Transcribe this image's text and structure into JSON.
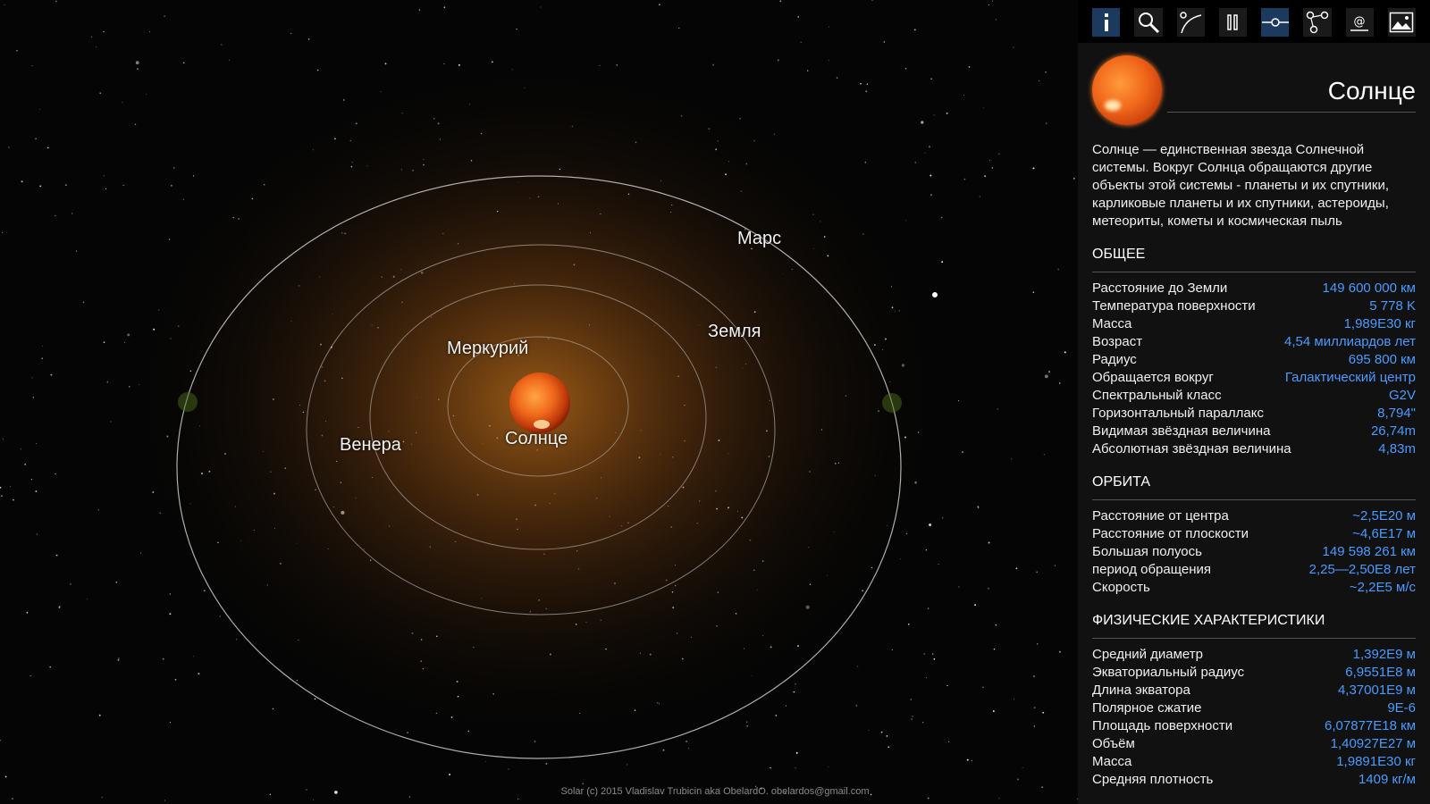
{
  "scene": {
    "labels": {
      "mars": "Марс",
      "earth": "Земля",
      "mercury": "Меркурий",
      "venus": "Венера",
      "sun": "Солнце"
    },
    "credit": "Solar (c) 2015 Vladislav Trubicin aka ObelardO. obelardos@gmail.com"
  },
  "toolbar": {
    "icons": [
      "info-icon",
      "search-icon",
      "orbit-path-icon",
      "pause-icon",
      "ecliptic-icon",
      "share-nodes-icon",
      "at-icon",
      "image-icon"
    ],
    "active": [
      "info-icon",
      "ecliptic-icon"
    ],
    "colors": {
      "accent": "#1c3a5e",
      "value": "#4a9bff"
    }
  },
  "panel": {
    "title": "Солнце",
    "description": "Солнце — единственная звезда Солнечной системы. Вокруг Солнца обращаются другие объекты этой системы - планеты и их спутники, карликовые планеты и их спутники, астероиды, метеориты, кометы и космическая пыль",
    "sections": [
      {
        "title": "ОБЩЕЕ",
        "rows": [
          {
            "k": "Расстояние до Земли",
            "v": "149 600 000 км"
          },
          {
            "k": "Температура поверхности",
            "v": "5 778 K"
          },
          {
            "k": "Масса",
            "v": "1,989E30 кг"
          },
          {
            "k": "Возраст",
            "v": "4,54 миллиардов лет"
          },
          {
            "k": "Радиус",
            "v": "695 800 км"
          },
          {
            "k": "Обращается вокруг",
            "v": "Галактический центр"
          },
          {
            "k": "Спектральный класс",
            "v": "G2V"
          },
          {
            "k": "Горизонтальный параллакс",
            "v": "8,794\""
          },
          {
            "k": "Видимая звёздная величина",
            "v": "26,74m"
          },
          {
            "k": "Абсолютная звёздная величина",
            "v": "4,83m"
          }
        ]
      },
      {
        "title": "ОРБИТА",
        "rows": [
          {
            "k": "Расстояние от центра",
            "v": "~2,5E20 м"
          },
          {
            "k": "Расстояние от плоскости",
            "v": "~4,6E17 м"
          },
          {
            "k": "Большая полуось",
            "v": "149 598 261 км"
          },
          {
            "k": "период обращения",
            "v": "2,25—2,50E8 лет"
          },
          {
            "k": "Скорость",
            "v": "~2,2E5 м/с"
          }
        ]
      },
      {
        "title": "ФИЗИЧЕСКИЕ ХАРАКТЕРИСТИКИ",
        "rows": [
          {
            "k": "Средний диаметр",
            "v": "1,392E9 м"
          },
          {
            "k": "Экваториальный радиус",
            "v": "6,9551E8 м"
          },
          {
            "k": "Длина экватора",
            "v": "4,37001E9 м"
          },
          {
            "k": "Полярное сжатие",
            "v": "9E-6"
          },
          {
            "k": "Площадь поверхности",
            "v": "6,07877E18 км"
          },
          {
            "k": "Объём",
            "v": "1,40927E27 м"
          },
          {
            "k": "Масса",
            "v": "1,9891E30 кг"
          },
          {
            "k": "Средняя плотность",
            "v": "1409 кг/м"
          }
        ]
      }
    ]
  }
}
